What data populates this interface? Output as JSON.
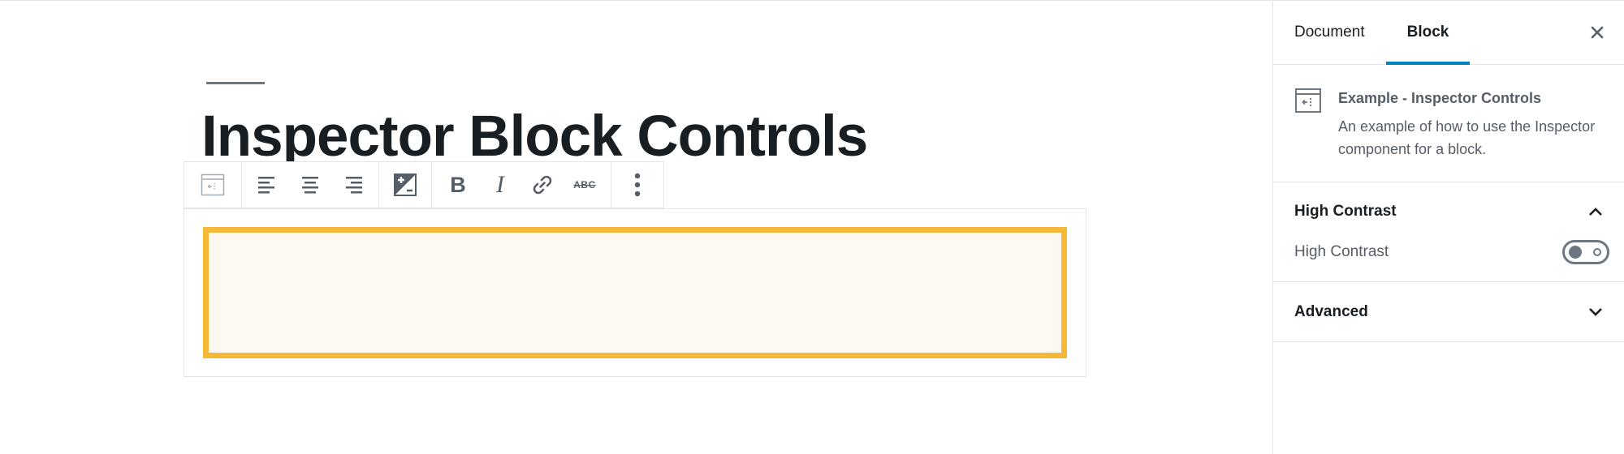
{
  "editor": {
    "post_title": "Inspector Block Controls"
  },
  "toolbar": {
    "bold_label": "B",
    "italic_label": "I",
    "strikethrough_label": "ABC"
  },
  "sidebar": {
    "tabs": [
      {
        "label": "Document"
      },
      {
        "label": "Block"
      }
    ],
    "active_tab": "Block",
    "block_card": {
      "title": "Example - Inspector Controls",
      "description": "An example of how to use the Inspector component for a block."
    },
    "panels": [
      {
        "title": "High Contrast",
        "expanded": true,
        "toggle_label": "High Contrast",
        "toggle_on": false
      },
      {
        "title": "Advanced",
        "expanded": false
      }
    ]
  },
  "colors": {
    "highlight_border": "#f4b937",
    "highlight_fill": "#fef9f0",
    "active_tab_underline": "#0085ba"
  }
}
